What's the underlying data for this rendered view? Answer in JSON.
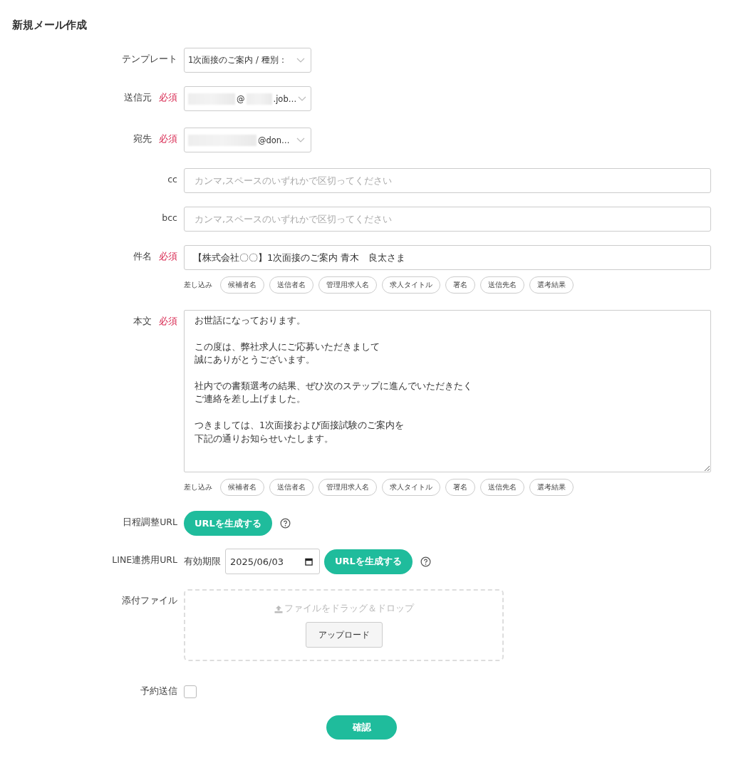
{
  "page_title": "新規メール作成",
  "template": {
    "label": "テンプレート",
    "value": "1次面接のご案内 / 種別："
  },
  "sender": {
    "label": "送信元",
    "required": "必須",
    "segments": [
      {
        "kind": "blur"
      },
      {
        "kind": "text",
        "text": "@"
      },
      {
        "kind": "blur"
      },
      {
        "kind": "text",
        "text": ".job…"
      }
    ]
  },
  "recipient": {
    "label": "宛先",
    "required": "必須",
    "segments": [
      {
        "kind": "blur"
      },
      {
        "kind": "text",
        "text": "@don…"
      }
    ]
  },
  "cc": {
    "label": "cc",
    "placeholder": "カンマ,スペースのいずれかで区切ってください"
  },
  "bcc": {
    "label": "bcc",
    "placeholder": "カンマ,スペースのいずれかで区切ってください"
  },
  "subject": {
    "label": "件名",
    "required": "必須",
    "value": "【株式会社〇〇】1次面接のご案内 青木　良太さま"
  },
  "subject_inserts": {
    "label": "差し込み",
    "chips": [
      "候補者名",
      "送信者名",
      "管理用求人名",
      "求人タイトル",
      "署名",
      "送信先名",
      "選考結果"
    ]
  },
  "body": {
    "label": "本文",
    "required": "必須",
    "paragraphs": [
      [
        "お世話になっております。"
      ],
      [
        "この度は、弊社求人にご応募いただきまして",
        "誠にありがとうございます。"
      ],
      [
        "社内での書類選考の結果、ぜひ次のステップに進んでいただきたく",
        "ご連絡を差し上げました。"
      ],
      [
        "つきましては、1次面接および面接試験のご案内を",
        "下記の通りお知らせいたします。"
      ]
    ]
  },
  "body_inserts": {
    "label": "差し込み",
    "chips": [
      "候補者名",
      "送信者名",
      "管理用求人名",
      "求人タイトル",
      "署名",
      "送信先名",
      "選考結果"
    ]
  },
  "schedule_url": {
    "label": "日程調整URL",
    "button": "URLを生成する"
  },
  "line_url": {
    "label": "LINE連携用URL",
    "expiry_label": "有効期限",
    "expiry_value": "2025/06/03",
    "button": "URLを生成する"
  },
  "attachment": {
    "label": "添付ファイル",
    "drop_text": "ファイルをドラッグ＆ドロップ",
    "button": "アップロード"
  },
  "scheduled_send": {
    "label": "予約送信",
    "checked": false
  },
  "confirm_button": "確認"
}
